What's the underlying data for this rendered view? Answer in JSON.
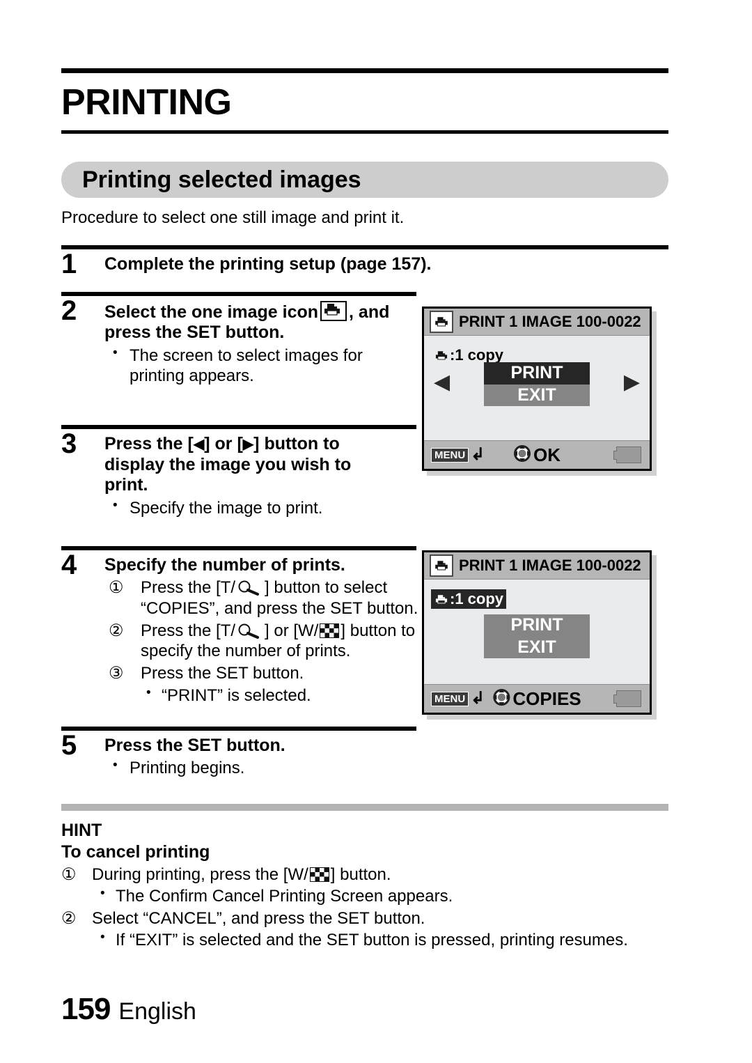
{
  "chapter": {
    "title": "PRINTING"
  },
  "section": {
    "heading": "Printing selected images",
    "intro": "Procedure to select one still image and print it."
  },
  "steps": [
    {
      "num": "1",
      "head": "Complete the printing setup (page 157)."
    },
    {
      "num": "2",
      "head_a": "Select the one image icon",
      "head_b": ", and press the SET button.",
      "bullet1": "The screen to select images for printing appears."
    },
    {
      "num": "3",
      "head_a": "Press the [",
      "head_b": "] or [",
      "head_c": "] button to display the image you wish to print.",
      "bullet1": "Specify the image to print."
    },
    {
      "num": "4",
      "head": "Specify the number of prints.",
      "item1_num": "①",
      "item1_a": "Press the [T/",
      "item1_b": "] button to select “COPIES”, and press the SET button.",
      "item2_num": "②",
      "item2_a": "Press the [T/",
      "item2_b": "] or [W/",
      "item2_c": "] button to specify the number of prints.",
      "item3_num": "③",
      "item3_a": "Press the SET button.",
      "item3_sub": "“PRINT” is selected."
    },
    {
      "num": "5",
      "head": "Press the SET button.",
      "bullet1": "Printing begins."
    }
  ],
  "screens": [
    {
      "title": "PRINT 1 IMAGE 100-0022",
      "copies_label": ":1 copy",
      "copies_highlighted": false,
      "arrow_left": "◀",
      "arrow_right": "▶",
      "options": [
        {
          "label": "PRINT",
          "selected": true
        },
        {
          "label": "EXIT",
          "selected": false
        }
      ],
      "menu_label": "MENU",
      "return_glyph": "↲",
      "action_label": "OK"
    },
    {
      "title": "PRINT 1 IMAGE  100-0022",
      "copies_label": ":1 copy",
      "copies_highlighted": true,
      "arrow_left": "",
      "arrow_right": "",
      "options": [
        {
          "label": "PRINT",
          "selected": false
        },
        {
          "label": "EXIT",
          "selected": false
        }
      ],
      "menu_label": "MENU",
      "return_glyph": "↲",
      "action_label": "COPIES"
    }
  ],
  "hint": {
    "label": "HINT",
    "subtitle": "To cancel printing",
    "item1_num": "①",
    "item1_a": "During printing, press the [W/",
    "item1_b": "] button.",
    "item1_sub": "The Confirm Cancel Printing Screen appears.",
    "item2_num": "②",
    "item2_a": "Select “CANCEL”, and press the SET button.",
    "item2_sub": "If “EXIT” is selected and the SET button is pressed, printing resumes."
  },
  "footer": {
    "page_number": "159",
    "language": "English"
  },
  "icons": {
    "printer": "printer-icon",
    "telephoto": "magnifier-icon",
    "wide": "checkerboard-icon",
    "dpad": "four-way-pad-icon",
    "battery": "battery-icon"
  },
  "colors": {
    "section_bar": "#cdcdcd",
    "hint_bar": "#b3b3b3",
    "lcd_body": "#e9ebec",
    "lcd_chrome": "#b6b6b6",
    "selected": "#262626",
    "unselected": "#858585"
  }
}
